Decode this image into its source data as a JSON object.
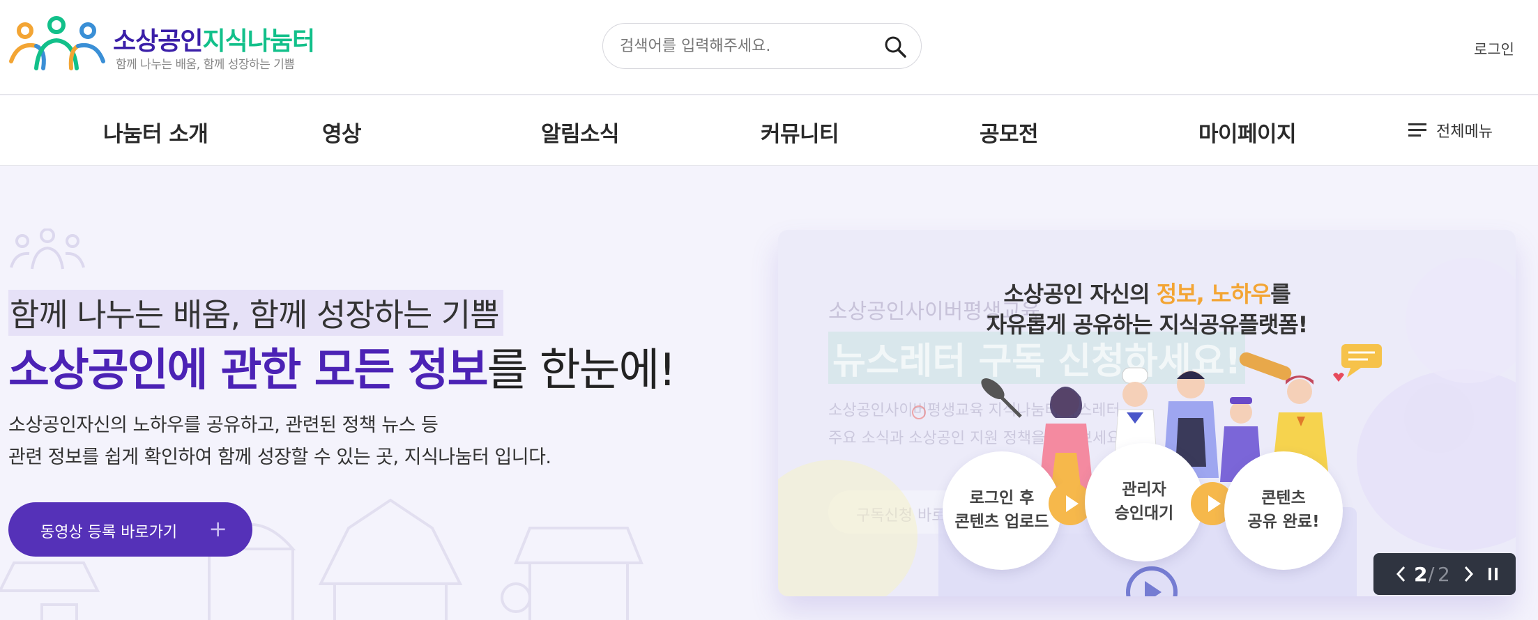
{
  "brand": {
    "title_part1": "소상공인",
    "title_part2": "지식나눔터",
    "subtitle": "함께 나누는 배움, 함께 성장하는 기쁨",
    "colors": {
      "purple": "#3b1fa8",
      "green": "#12c08a",
      "orange": "#f3a534",
      "blue": "#3a8fd6"
    }
  },
  "search": {
    "placeholder": "검색어를 입력해주세요.",
    "value": "",
    "icon": "search-icon"
  },
  "header": {
    "login_label": "로그인"
  },
  "nav": {
    "items": [
      {
        "label": "나눔터 소개"
      },
      {
        "label": "영상"
      },
      {
        "label": "알림소식"
      },
      {
        "label": "커뮤니티"
      },
      {
        "label": "공모전"
      },
      {
        "label": "마이페이지"
      }
    ],
    "all_menu_label": "전체메뉴",
    "all_menu_icon": "hamburger-icon"
  },
  "hero": {
    "line1": "함께 나누는 배움, 함께 성장하는 기쁨",
    "line2_emphasis": "소상공인에 관한 모든 정보",
    "line2_rest": "를 한눈에!",
    "desc_line1": "소상공인자신의 노하우를 공유하고, 관련된 정책 뉴스 등",
    "desc_line2": "관련 정보를 쉽게 확인하여 함께 성장할 수 있는 곳, 지식나눔터 입니다.",
    "cta_label": "동영상 등록 바로가기",
    "cta_icon": "plus-icon",
    "accent": "#5531b8"
  },
  "slider": {
    "headline_part1": "소상공인 자신의 ",
    "headline_highlight": "정보, 노하우",
    "headline_part2": "를",
    "headline_line2": "자유롭게 공유하는 지식공유플랫폼!",
    "faded_title_small": "소상공인사이버평생교육",
    "faded_title_big": "뉴스레터 구독 신청하세요!",
    "faded_desc_1": "소상공인사이버평생교육 지식나눔터 뉴스레터",
    "faded_desc_2": "주요 소식과 소상공인 지원 정책을 받아보세요",
    "faded_button": "구독신청 바로가기",
    "steps": [
      {
        "line1": "로그인 후",
        "line2": "콘텐츠 업로드"
      },
      {
        "line1": "관리자",
        "line2": "승인대기"
      },
      {
        "line1": "콘텐츠",
        "line2": "공유 완료!"
      }
    ],
    "current_page": "2",
    "separator": "/",
    "total_pages": "2",
    "controls": {
      "prev_icon": "chevron-left-icon",
      "next_icon": "chevron-right-icon",
      "pause_icon": "pause-icon"
    }
  }
}
